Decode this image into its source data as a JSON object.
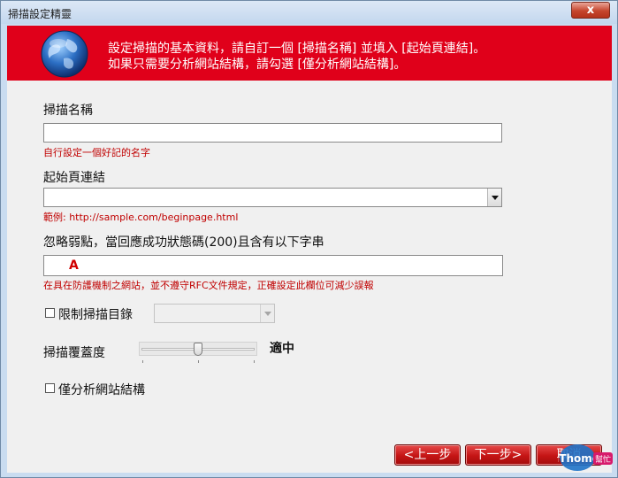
{
  "window": {
    "title": "掃描設定精靈",
    "close_label": "x"
  },
  "banner": {
    "line1": "設定掃描的基本資料，請自訂一個 [掃描名稱] 並填入 [起始頁連結]。",
    "line2": "如果只需要分析網站結構，請勾選 [僅分析網站結構]。"
  },
  "form": {
    "scan_name": {
      "label": "掃描名稱",
      "value": "",
      "hint": "自行設定一個好記的名字"
    },
    "start_url": {
      "label": "起始頁連結",
      "value": "",
      "hint": "範例: http://sample.com/beginpage.html"
    },
    "ignore_weak": {
      "label": "忽略弱點，當回應成功狀態碼(200)且含有以下字串",
      "value": "A",
      "hint": "在具在防護機制之網站，並不遵守RFC文件規定，正確設定此欄位可減少誤報"
    },
    "limit_dir": {
      "label": "限制掃描目錄",
      "checked": false,
      "value": ""
    },
    "coverage": {
      "label": "掃描覆蓋度",
      "level_label": "適中",
      "position": 0.5
    },
    "structure_only": {
      "label": "僅分析網站結構",
      "checked": false
    }
  },
  "buttons": {
    "back": "<上一步",
    "next": "下一步>",
    "cancel": "取消"
  },
  "watermark": {
    "text": "iThome",
    "badge": "幫忙"
  },
  "colors": {
    "banner": "#e0001a",
    "hint": "#c00000",
    "button": "#c41414"
  }
}
